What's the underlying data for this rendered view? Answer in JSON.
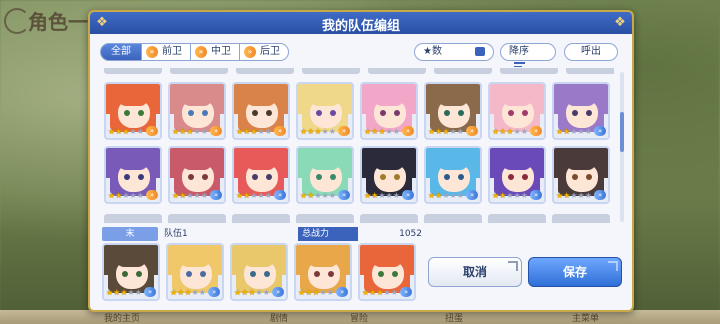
{
  "background": {
    "title": "角色一览",
    "bottom_tabs": [
      "我的主页",
      "剧情",
      "冒险",
      "扭蛋",
      "主菜单"
    ]
  },
  "modal": {
    "title": "我的队伍编组"
  },
  "filters": {
    "tabs": [
      {
        "label": "全部",
        "active": true
      },
      {
        "label": "前卫",
        "active": false
      },
      {
        "label": "中卫",
        "active": false
      },
      {
        "label": "后卫",
        "active": false
      }
    ],
    "sort_by": "★数",
    "order": "降序",
    "call_out": "呼出"
  },
  "roster": [
    {
      "hair": "#e8663a",
      "eye": "#3a7a3a",
      "stars": 3,
      "arrow": "orange"
    },
    {
      "hair": "#d98a8a",
      "eye": "#4a7ab8",
      "stars": 3,
      "arrow": "orange"
    },
    {
      "hair": "#d9834a",
      "eye": "#4a3a2a",
      "stars": 3,
      "arrow": "orange"
    },
    {
      "hair": "#f0d88a",
      "eye": "#6a4aa0",
      "stars": 3,
      "arrow": "orange"
    },
    {
      "hair": "#f2a6c8",
      "eye": "#7a3a6a",
      "stars": 3,
      "arrow": "orange"
    },
    {
      "hair": "#8a6a4a",
      "eye": "#2a6a5a",
      "stars": 3,
      "arrow": "orange"
    },
    {
      "hair": "#f5b8c8",
      "eye": "#a03a6a",
      "stars": 3,
      "arrow": "orange"
    },
    {
      "hair": "#9a7ac8",
      "eye": "#4a3a6a",
      "stars": 2,
      "arrow": "blue"
    },
    {
      "hair": "#7a5ab8",
      "eye": "#3a3a7a",
      "stars": 2,
      "arrow": "orange"
    },
    {
      "hair": "#c85a6a",
      "eye": "#7a3a3a",
      "stars": 2,
      "arrow": "blue"
    },
    {
      "hair": "#e85a5a",
      "eye": "#4a3a6a",
      "stars": 2,
      "arrow": "blue"
    },
    {
      "hair": "#8adab8",
      "eye": "#3a8a6a",
      "stars": 2,
      "arrow": "blue"
    },
    {
      "hair": "#2a2a3a",
      "eye": "#a07a2a",
      "stars": 2,
      "arrow": "blue"
    },
    {
      "hair": "#5ab8e8",
      "eye": "#2a5a8a",
      "stars": 2,
      "arrow": "blue"
    },
    {
      "hair": "#6a4ab8",
      "eye": "#8a2a3a",
      "stars": 2,
      "arrow": "blue"
    },
    {
      "hair": "#4a3a3a",
      "eye": "#7a4a2a",
      "stars": 2,
      "arrow": "blue"
    }
  ],
  "team": {
    "slot_label": "末",
    "name": "队伍1",
    "power_label": "总战力",
    "power_value": "1052",
    "members": [
      {
        "hair": "#5a4a3a",
        "eye": "#3a6a3a",
        "stars": 3,
        "arrow": "blue"
      },
      {
        "hair": "#f0c86a",
        "eye": "#4a6aa0",
        "stars": 3,
        "arrow": "blue"
      },
      {
        "hair": "#e8c86a",
        "eye": "#3a6a8a",
        "stars": 3,
        "arrow": "blue"
      },
      {
        "hair": "#e8a84a",
        "eye": "#7a3a3a",
        "stars": 3,
        "arrow": "blue"
      },
      {
        "hair": "#e8663a",
        "eye": "#3a7a3a",
        "stars": 3,
        "arrow": "blue"
      }
    ]
  },
  "actions": {
    "cancel": "取消",
    "save": "保存"
  }
}
